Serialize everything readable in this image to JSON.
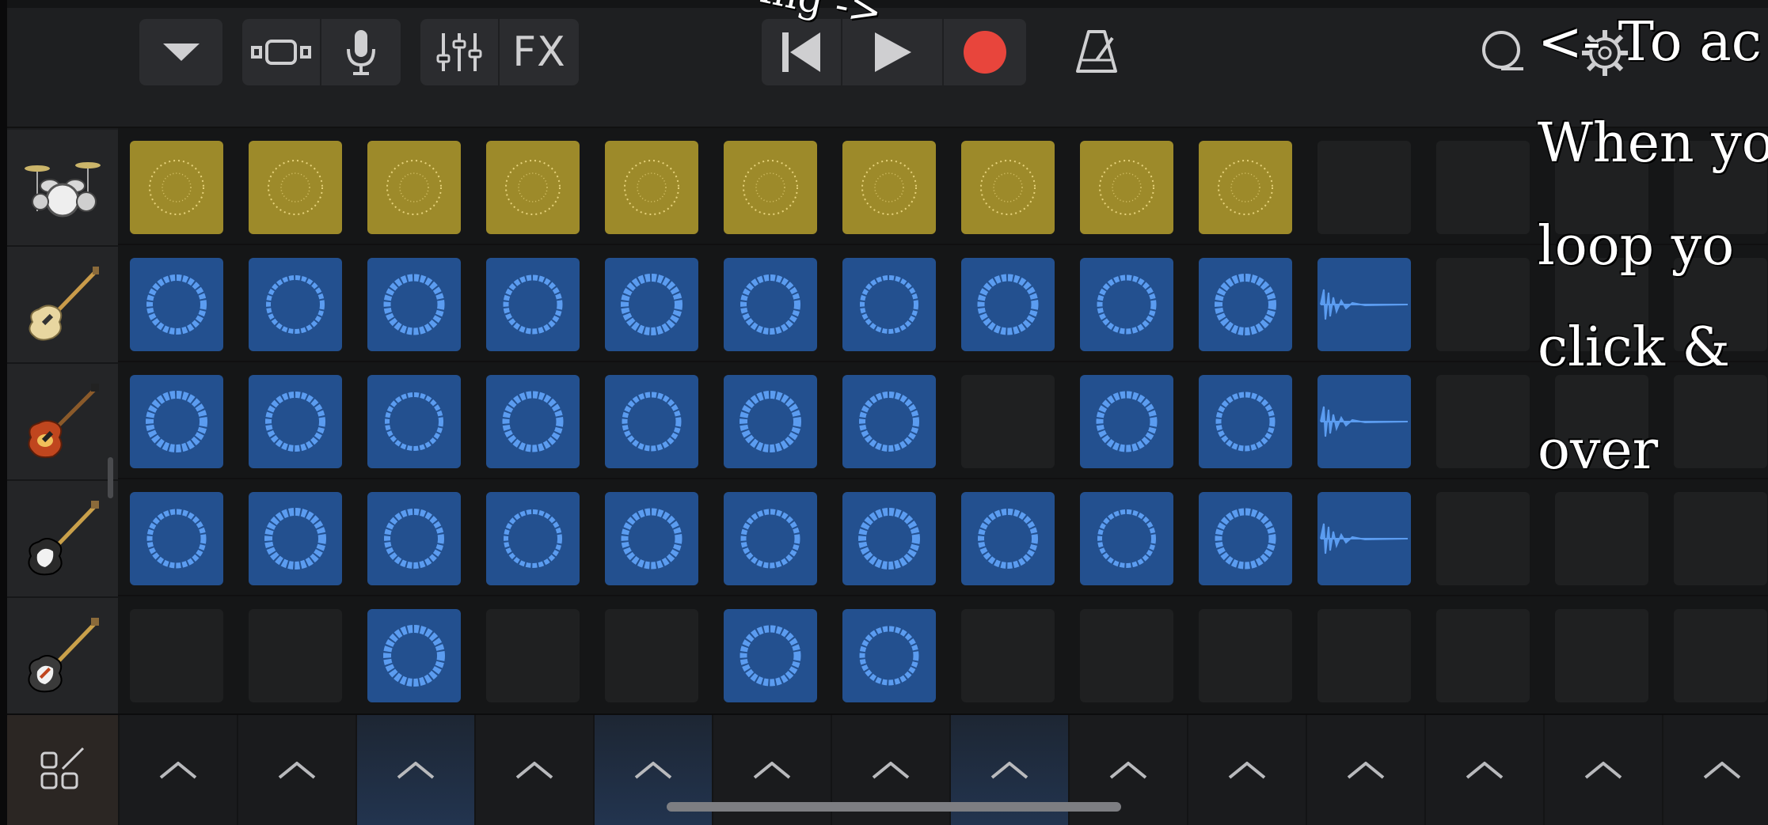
{
  "toolbar": {
    "fx_label": "FX",
    "record_color": "#e8453c",
    "icons": [
      "chevron-down-icon",
      "view-toggle-icon",
      "microphone-icon",
      "mixer-sliders-icon",
      "skip-back-icon",
      "play-icon",
      "record-icon",
      "metronome-icon",
      "loop-icon",
      "settings-gear-icon"
    ]
  },
  "tracks": [
    {
      "instrument": "drum-kit-icon"
    },
    {
      "instrument": "bass-guitar-icon"
    },
    {
      "instrument": "electric-guitar-sunburst-icon"
    },
    {
      "instrument": "electric-guitar-strat-icon"
    },
    {
      "instrument": "electric-guitar-strat-alt-icon"
    }
  ],
  "grid": {
    "rows": [
      [
        "gold",
        "gold",
        "gold",
        "gold",
        "gold",
        "gold",
        "gold",
        "gold",
        "gold",
        "gold",
        "empty",
        "empty",
        "empty",
        "empty"
      ],
      [
        "blue",
        "blue",
        "blue",
        "blue",
        "blue",
        "blue",
        "blue",
        "blue",
        "blue",
        "blue",
        "wave",
        "empty",
        "empty",
        "empty"
      ],
      [
        "blue",
        "blue",
        "blue",
        "blue",
        "blue",
        "blue",
        "blue",
        "empty",
        "blue",
        "blue",
        "wave",
        "empty",
        "empty",
        "empty"
      ],
      [
        "blue",
        "blue",
        "blue",
        "blue",
        "blue",
        "blue",
        "blue",
        "blue",
        "blue",
        "blue",
        "wave",
        "empty",
        "empty",
        "empty"
      ],
      [
        "empty",
        "empty",
        "blue",
        "empty",
        "empty",
        "blue",
        "blue",
        "empty",
        "empty",
        "empty",
        "empty",
        "empty",
        "empty",
        "empty"
      ]
    ],
    "colors": {
      "gold": "#9d8a2a",
      "blue": "#23508f",
      "loop": "#5b9cf0",
      "empty": "#1f2021"
    }
  },
  "bottom_bar": {
    "triggers": 14,
    "lit_triggers": [
      2,
      4,
      7
    ],
    "icons": [
      "edit-grid-icon",
      "chevron-up-icon"
    ]
  },
  "overlay": {
    "partial_top_text": "ing ->",
    "line1": "<- To ac",
    "line2": "When yo",
    "line3": "loop yo",
    "line4": "click &",
    "line5": "over"
  }
}
